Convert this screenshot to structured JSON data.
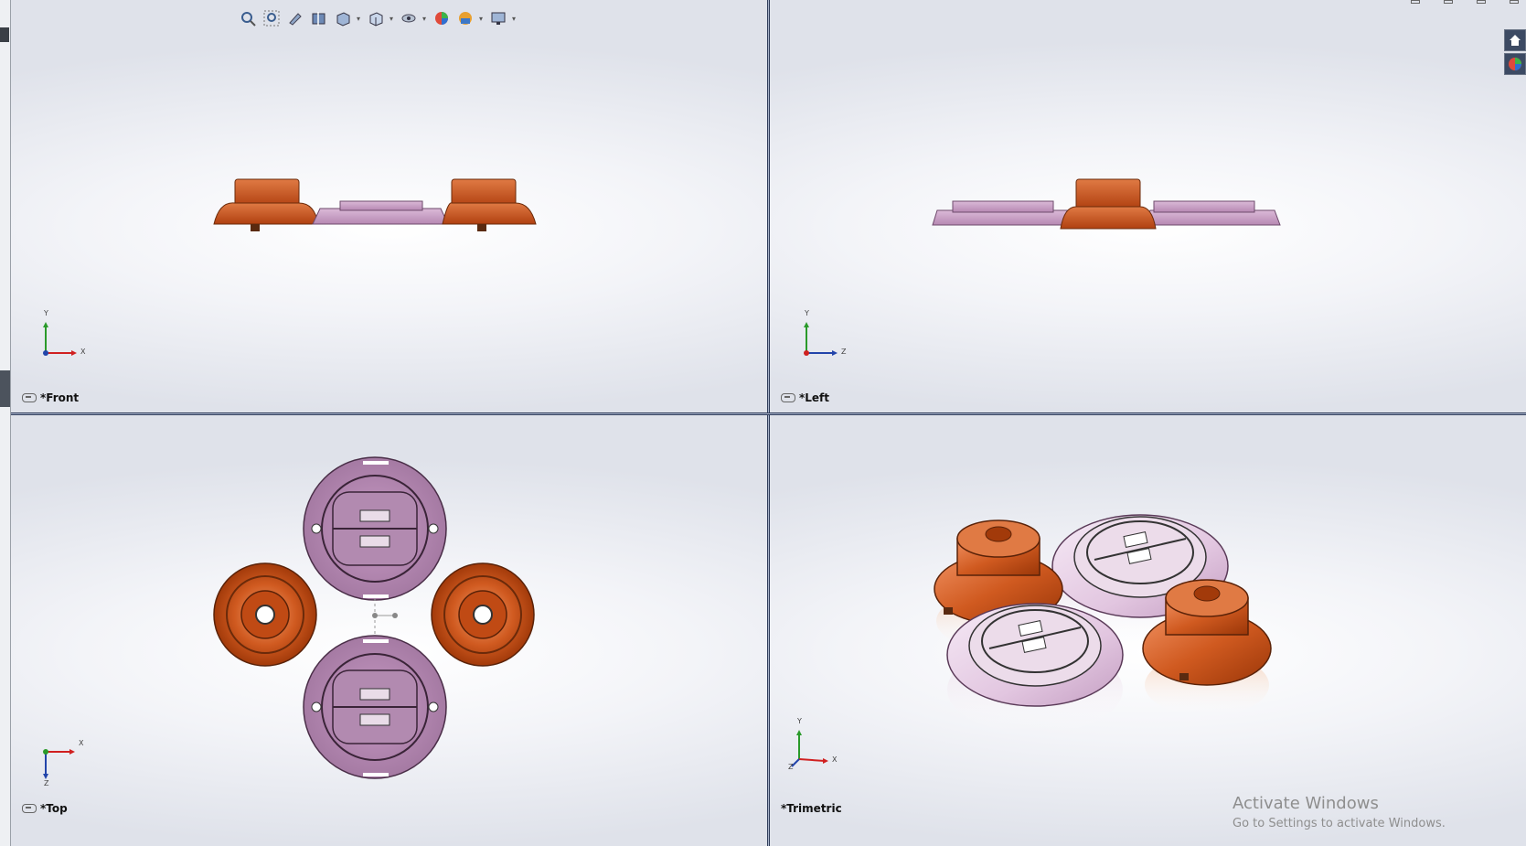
{
  "viewports": {
    "front": {
      "label": "*Front",
      "triad_axes": [
        "Y",
        "X"
      ]
    },
    "left": {
      "label": "*Left",
      "triad_axes": [
        "Y",
        "Z"
      ]
    },
    "top": {
      "label": "*Top",
      "triad_axes": [
        "X",
        "Z"
      ]
    },
    "trimetric": {
      "label": "*Trimetric",
      "triad_axes": [
        "Y",
        "X",
        "Z"
      ]
    }
  },
  "toolbar": {
    "icons": [
      "zoom-to-fit-icon",
      "zoom-to-area-icon",
      "previous-view-icon",
      "section-view-icon",
      "view-orientation-icon",
      "display-style-icon",
      "hide-show-items-icon",
      "edit-appearance-icon",
      "apply-scene-icon",
      "view-settings-icon"
    ]
  },
  "task_pane": {
    "icons": [
      "home-icon",
      "appearances-icon"
    ]
  },
  "watermark": {
    "title": "Activate Windows",
    "subtitle": "Go to Settings to activate Windows."
  },
  "colors": {
    "orange_part": "#c8501e",
    "pink_part": "#c79ac4",
    "splitter": "#2f3c5a"
  }
}
